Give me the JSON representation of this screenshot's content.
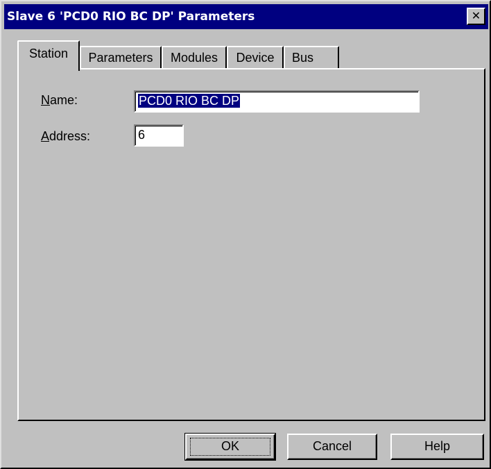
{
  "window": {
    "title": "Slave 6 'PCD0 RIO BC DP' Parameters",
    "close_glyph": "✕"
  },
  "tabs": [
    {
      "label": "Station",
      "active": true
    },
    {
      "label": "Parameters",
      "active": false
    },
    {
      "label": "Modules",
      "active": false
    },
    {
      "label": "Device",
      "active": false
    },
    {
      "label": "Bus",
      "active": false
    }
  ],
  "station": {
    "name_label_mnemonic": "N",
    "name_label_rest": "ame:",
    "name_value": "PCD0 RIO BC DP",
    "address_label_mnemonic": "A",
    "address_label_rest": "ddress:",
    "address_value": "6"
  },
  "buttons": {
    "ok": "OK",
    "cancel": "Cancel",
    "help": "Help"
  },
  "colors": {
    "face": "#c0c0c0",
    "title_bar": "#000080",
    "selection": "#000080"
  }
}
